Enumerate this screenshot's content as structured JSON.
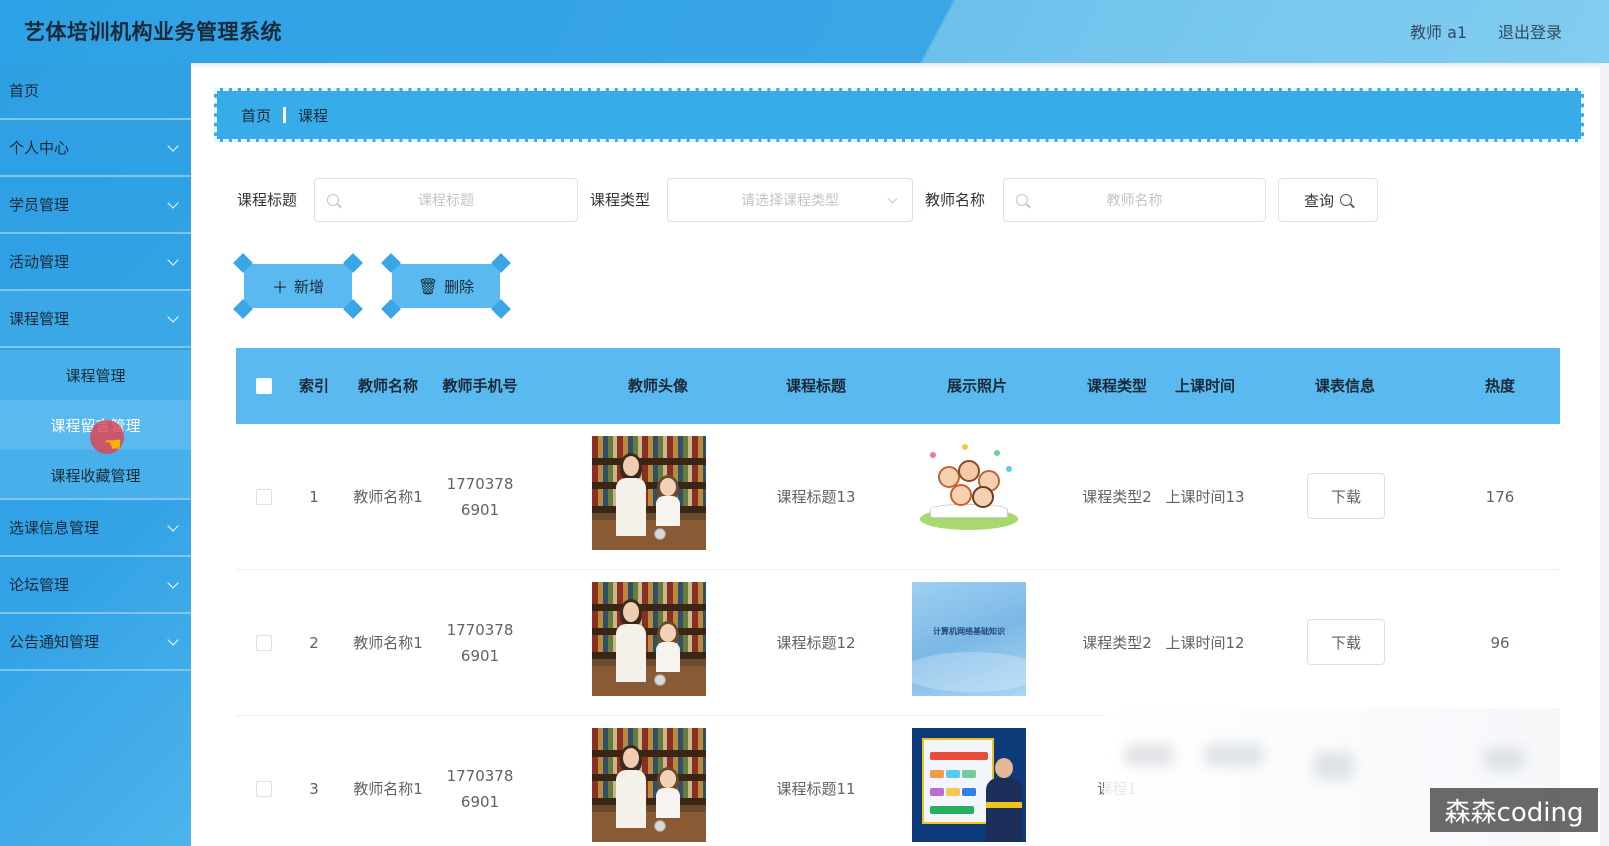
{
  "app": {
    "title": "艺体培训机构业务管理系统",
    "user": "教师 a1",
    "logout": "退出登录"
  },
  "sidebar": {
    "items": [
      {
        "label": "首页"
      },
      {
        "label": "个人中心"
      },
      {
        "label": "学员管理"
      },
      {
        "label": "活动管理"
      },
      {
        "label": "课程管理"
      },
      {
        "label": "选课信息管理"
      },
      {
        "label": "论坛管理"
      },
      {
        "label": "公告通知管理"
      }
    ],
    "submenu": [
      {
        "label": "课程管理"
      },
      {
        "label": "课程留言管理"
      },
      {
        "label": "课程收藏管理"
      }
    ]
  },
  "breadcrumb": {
    "home": "首页",
    "current": "课程"
  },
  "search": {
    "title_label": "课程标题",
    "title_placeholder": "课程标题",
    "type_label": "课程类型",
    "type_placeholder": "请选择课程类型",
    "teacher_label": "教师名称",
    "teacher_placeholder": "教师名称",
    "query_button": "查询"
  },
  "actions": {
    "add": "新增",
    "delete": "删除"
  },
  "table": {
    "columns": [
      "索引",
      "教师名称",
      "教师手机号",
      "教师头像",
      "课程标题",
      "展示照片",
      "课程类型",
      "上课时间",
      "课表信息",
      "热度"
    ],
    "rows": [
      {
        "index": "1",
        "teacher_name": "教师名称1",
        "teacher_phone": "17703786901",
        "course_title": "课程标题13",
        "course_type": "课程类型2",
        "class_time": "上课时间13",
        "schedule": "下载",
        "heat": "176"
      },
      {
        "index": "2",
        "teacher_name": "教师名称1",
        "teacher_phone": "17703786901",
        "course_title": "课程标题12",
        "course_type": "课程类型2",
        "class_time": "上课时间12",
        "schedule": "下载",
        "heat": "96",
        "photo_text": "计算机网络基础知识"
      },
      {
        "index": "3",
        "teacher_name": "教师名称1",
        "teacher_phone": "17703786901",
        "course_title": "课程标题11",
        "course_type": "课程1"
      }
    ]
  },
  "watermark": "森森coding",
  "colors": {
    "header_blue": "#2ea2e6",
    "sidebar_blue": "#33a3e6",
    "table_header": "#5ab9ee"
  }
}
